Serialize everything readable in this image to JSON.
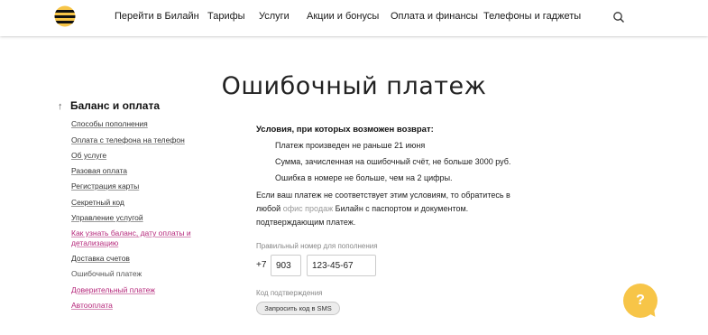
{
  "colors": {
    "brand_yellow": "#f7c548",
    "link_pink": "#b5267a",
    "text": "#1a1a1a"
  },
  "header": {
    "logo_icon": "beeline-logo-icon",
    "nav": [
      "Перейти в Билайн",
      "Тарифы",
      "Услуги",
      "Акции и бонусы",
      "Оплата и финансы",
      "Телефоны и гаджеты"
    ],
    "search_icon": "search-icon"
  },
  "title": "Ошибочный платеж",
  "sidebar": {
    "heading": "Баланс и оплата",
    "items": [
      "Способы пополнения",
      "Оплата с телефона на телефон",
      "Об услуге",
      "Разовая оплата",
      "Регистрация карты",
      "Секретный код",
      "Управление услугой",
      "Как узнать баланс, дату оплаты и",
      "детализацию",
      "Доставка счетов",
      "Ошибочный платеж",
      "Доверительный платеж",
      "Автооплата"
    ]
  },
  "content": {
    "conditions_title": "Условия, при которых возможен возврат:",
    "conditions": [
      "Платеж произведен не раньше 21 июня",
      "Сумма, зачисленная на ошибочный счёт, не больше 3000 руб.",
      "Ошибка в номере не больше, чем на 2 цифры."
    ],
    "para_line1": "Если ваш платеж не соответствует этим условиям, то обратитесь в",
    "para_line2_start": "любой ",
    "para_link": "офис продаж",
    "para_line2_end": " Билайн с паспортом и документом.",
    "para_line3": "подтверждающим платеж."
  },
  "form": {
    "number_label": "Правильный номер для пополнения",
    "prefix": "+7",
    "code_value": "903",
    "number_value": "123-45-67",
    "confirm_label": "Код подтверждения",
    "sms_button": "Запросить код в SMS"
  },
  "help": {
    "label": "?"
  }
}
